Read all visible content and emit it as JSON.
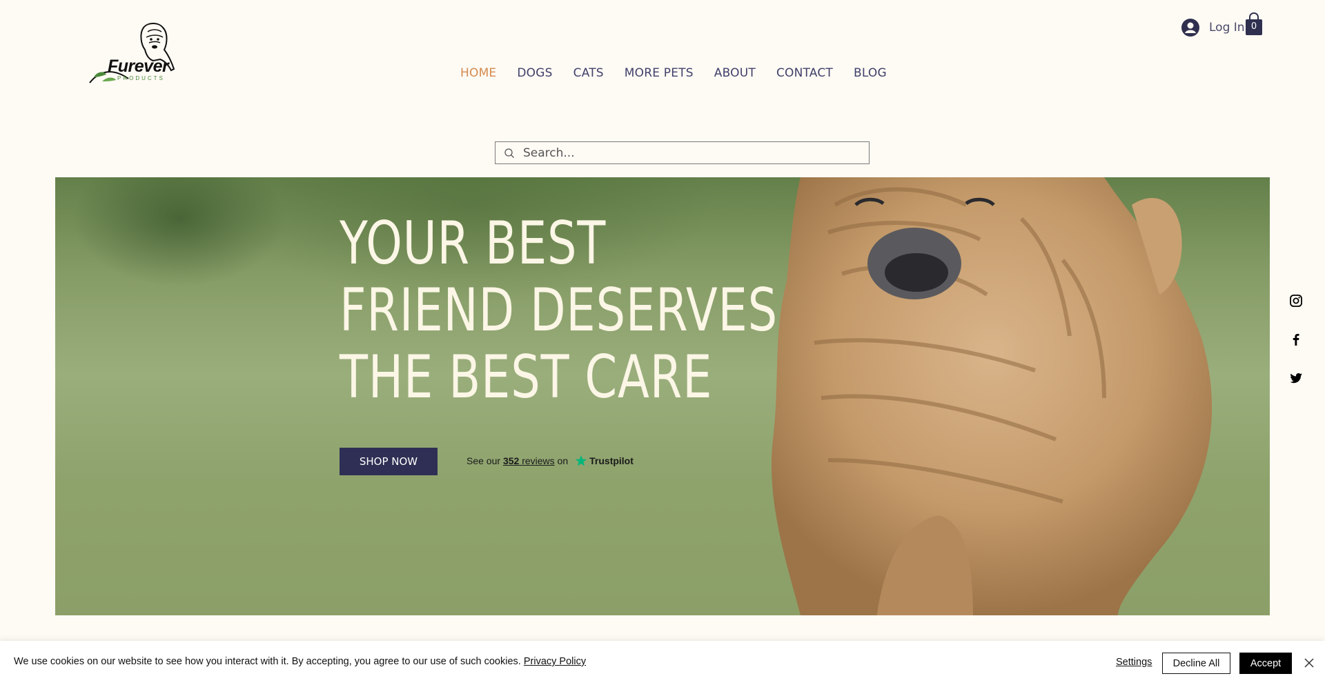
{
  "brand": {
    "name": "Furever",
    "tagline": "PRODUCTS"
  },
  "header": {
    "login_label": "Log In",
    "cart_count": "0"
  },
  "nav": {
    "items": [
      {
        "label": "HOME",
        "active": true
      },
      {
        "label": "DOGS"
      },
      {
        "label": "CATS"
      },
      {
        "label": "MORE PETS"
      },
      {
        "label": "ABOUT"
      },
      {
        "label": "CONTACT"
      },
      {
        "label": "BLOG"
      }
    ],
    "active_color": "#d48a4e"
  },
  "search": {
    "placeholder": "Search..."
  },
  "hero": {
    "title_lines": [
      "YOUR BEST",
      "FRIEND DESERVES",
      "THE BEST CARE"
    ],
    "cta_label": "SHOP NOW",
    "trustpilot": {
      "prefix": "See our",
      "count": "352",
      "reviews_word": "reviews",
      "suffix": "on",
      "brand": "Trustpilot"
    }
  },
  "social": {
    "icons": [
      "instagram-icon",
      "facebook-icon",
      "twitter-icon"
    ]
  },
  "cookie": {
    "message": "We use cookies on our website to see how you interact with it. By accepting, you agree to our use of such cookies.",
    "policy_link": "Privacy Policy",
    "settings_label": "Settings",
    "decline_label": "Decline All",
    "accept_label": "Accept"
  },
  "colors": {
    "background": "#fefaf4",
    "nav_text": "#40406a",
    "cta_bg": "#2f2f55",
    "trustpilot_green": "#00b67a"
  }
}
